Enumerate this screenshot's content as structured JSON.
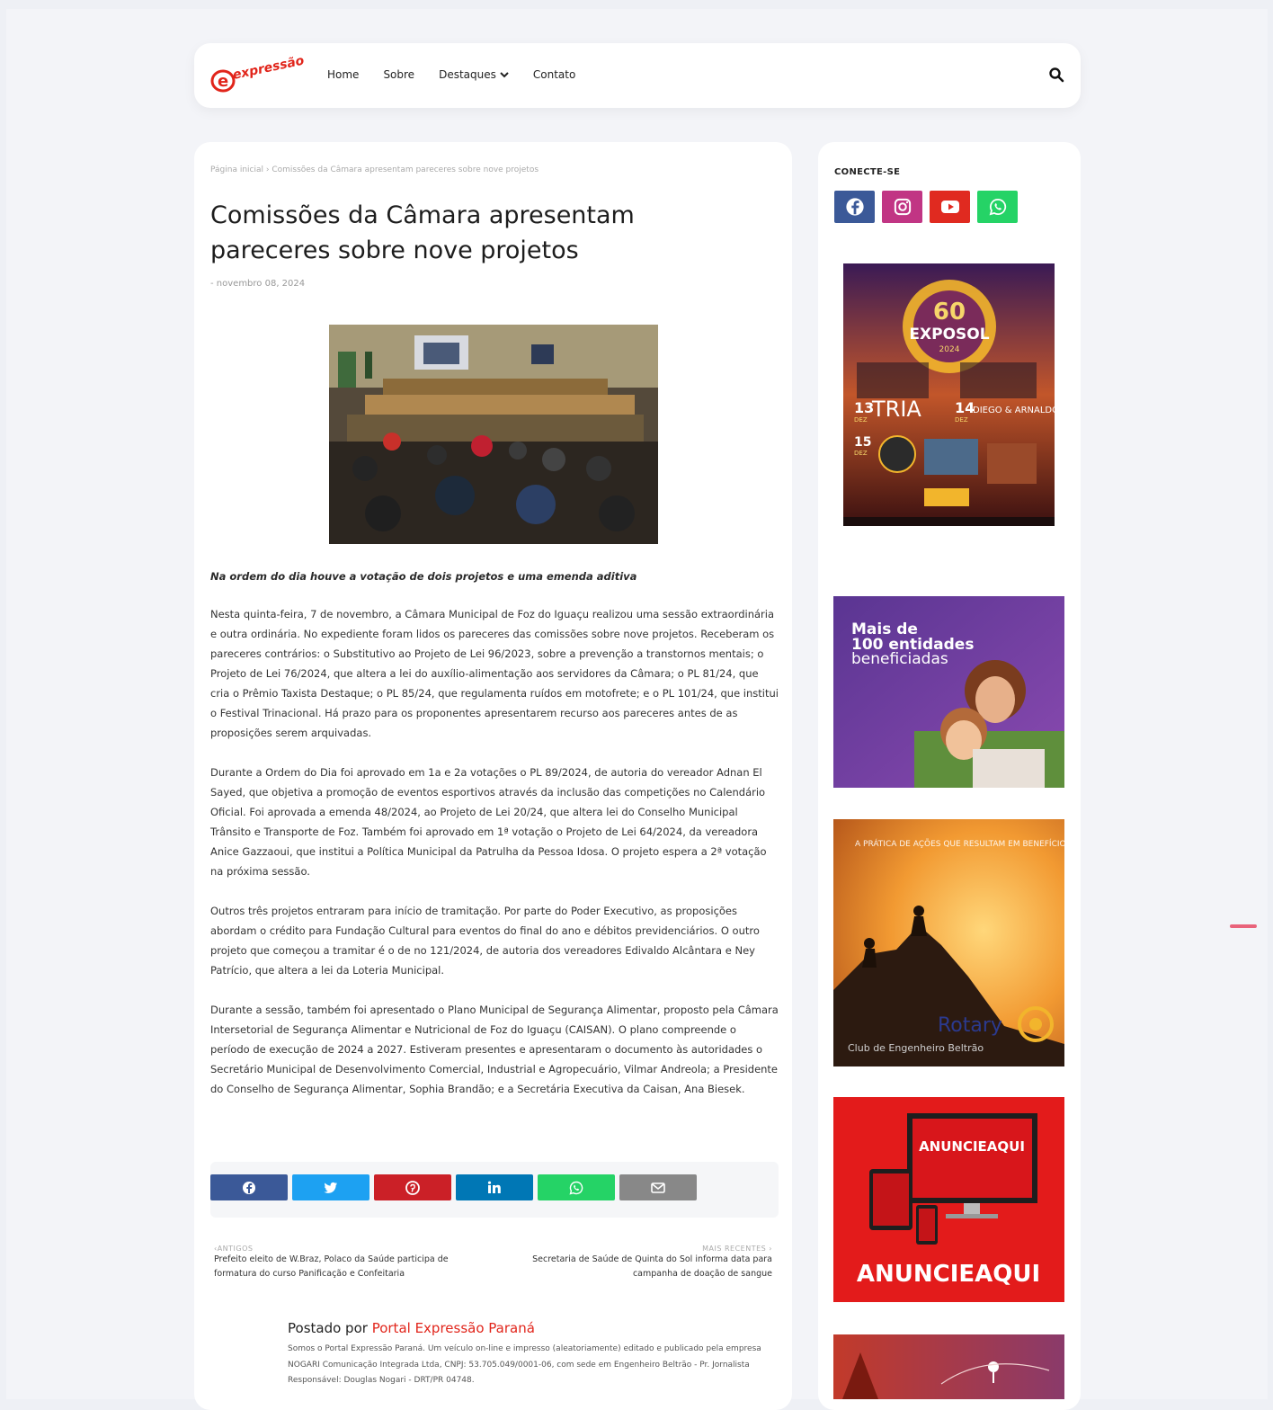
{
  "header": {
    "logo_text": "expressão",
    "nav": [
      {
        "label": "Home"
      },
      {
        "label": "Sobre"
      },
      {
        "label": "Destaques"
      },
      {
        "label": "Contato"
      }
    ]
  },
  "post": {
    "breadcrumb": "Página inicial › Comissões da Câmara apresentam pareceres sobre nove projetos",
    "title": "Comissões da Câmara apresentam pareceres sobre nove projetos",
    "date": "- novembro 08, 2024",
    "subtitle": "Na ordem do dia houve a votação de dois projetos e uma emenda aditiva",
    "paragraphs": [
      "Nesta quinta-feira, 7 de novembro, a Câmara Municipal de Foz do Iguaçu realizou uma sessão extraordinária e outra ordinária. No expediente foram lidos os pareceres das comissões sobre nove projetos. Receberam os pareceres contrários: o Substitutivo ao Projeto de Lei 96/2023, sobre a prevenção a transtornos mentais; o Projeto de Lei 76/2024, que altera a lei do auxílio-alimentação aos servidores da Câmara; o PL 81/24, que cria o Prêmio Taxista Destaque; o PL 85/24, que regulamenta ruídos em motofrete; e o PL 101/24, que institui o Festival Trinacional. Há prazo para os proponentes apresentarem recurso aos pareceres antes de as proposições serem arquivadas.",
      "Durante a Ordem do Dia foi aprovado em 1a e 2a votações o PL 89/2024, de autoria do vereador Adnan El Sayed, que objetiva a promoção de eventos esportivos através da inclusão das competições no Calendário Oficial. Foi aprovada a emenda 48/2024, ao Projeto de Lei 20/24, que altera lei do Conselho Municipal Trânsito e Transporte de Foz. Também foi aprovado em 1ª votação o Projeto de Lei 64/2024, da vereadora Anice Gazzaoui, que institui a Política Municipal da Patrulha da Pessoa Idosa. O projeto espera a 2ª votação na próxima sessão.",
      "Outros três projetos entraram para início de tramitação. Por parte do Poder Executivo, as proposições abordam o crédito para Fundação Cultural para eventos do final do ano e débitos previdenciários. O outro projeto que começou a tramitar é o de no 121/2024, de autoria dos vereadores Edivaldo Alcântara e Ney Patrício, que altera a lei da Loteria Municipal.",
      "Durante a sessão, também foi apresentado o Plano Municipal de Segurança Alimentar, proposto pela Câmara Intersetorial de Segurança Alimentar e Nutricional de Foz do Iguaçu (CAISAN). O plano compreende o período de execução de 2024 a 2027. Estiveram presentes e apresentaram o documento às autoridades o Secretário Municipal de Desenvolvimento Comercial, Industrial e Agropecuário, Vilmar Andreola; a Presidente do Conselho de Segurança Alimentar, Sophia Brandão; e a Secretária Executiva da Caisan, Ana Biesek."
    ]
  },
  "share": {
    "buttons": [
      {
        "icon": "facebook-icon",
        "color": "#3b5998"
      },
      {
        "icon": "twitter-icon",
        "color": "#1da1f2"
      },
      {
        "icon": "pinterest-icon",
        "color": "#cb2027"
      },
      {
        "icon": "linkedin-icon",
        "color": "#0077b5"
      },
      {
        "icon": "whatsapp-icon",
        "color": "#25d366"
      },
      {
        "icon": "email-icon",
        "color": "#888888"
      }
    ]
  },
  "post_nav": {
    "older_label": "ANTIGOS",
    "older_title": "Prefeito eleito de W.Braz, Polaco da Saúde participa de formatura do curso Panificação e Confeitaria",
    "newer_label": "MAIS RECENTES",
    "newer_title": "Secretaria de Saúde de Quinta do Sol informa data para campanha de doação de sangue"
  },
  "author": {
    "prefix": "Postado por",
    "name": "Portal Expressão Paraná",
    "bio": "Somos o Portal Expressão Paraná. Um veículo on-line e impresso (aleatoriamente) editado e publicado pela empresa NOGARI Comunicação Integrada Ltda, CNPJ: 53.705.049/0001-06, com sede em Engenheiro Beltrão - Pr. Jornalista Responsável: Douglas Nogari - DRT/PR 04748."
  },
  "sidebar": {
    "connect_title": "CONECTE-SE",
    "social": [
      {
        "icon": "facebook-icon",
        "color": "#3b5998"
      },
      {
        "icon": "instagram-icon",
        "color": "#c13584"
      },
      {
        "icon": "youtube-icon",
        "color": "#e02a20"
      },
      {
        "icon": "whatsapp-icon",
        "color": "#25d366"
      }
    ],
    "ads": {
      "exposol": {
        "badge_year": "60",
        "badge_name": "EXPOSOL",
        "badge_sub": "2024",
        "day1_num": "13",
        "day1_mon": "DEZ",
        "day1_artist": "TRIA",
        "day2_num": "14",
        "day2_mon": "DEZ",
        "day2_artist": "DIEGO & ARNALDO",
        "day3_num": "15",
        "day3_mon": "DEZ"
      },
      "entidades": {
        "line1": "Mais de",
        "line2": "100 entidades",
        "line3": "beneficiadas"
      },
      "rotary": {
        "top_text": "A PRÁTICA DE AÇÕES QUE RESULTAM EM BENEFÍCIO A",
        "brand": "Rotary",
        "club": "Club de Engenheiro Beltrão"
      },
      "anuncie": {
        "screen_text": "ANUNCIEAQUI",
        "big_text": "ANUNCIEAQUI"
      }
    }
  },
  "colors": {
    "accent": "#e1251b",
    "background": "#eef0f5"
  }
}
